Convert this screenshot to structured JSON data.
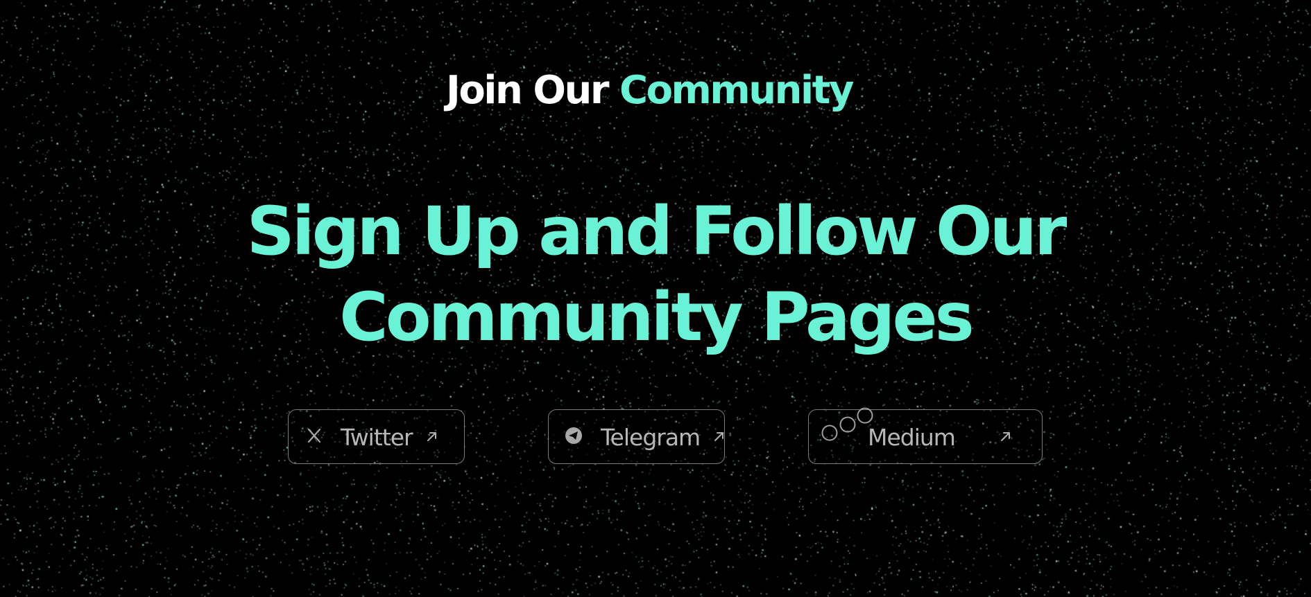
{
  "section": {
    "eyebrow_part1": "Join Our",
    "eyebrow_part2": "Community",
    "headline_line1": "Sign Up and Follow Our",
    "headline_line2": "Community Pages"
  },
  "links": [
    {
      "label": "Twitter",
      "icon": "x-logo-icon"
    },
    {
      "label": "Telegram",
      "icon": "telegram-icon"
    },
    {
      "label": "Medium",
      "icon": "medium-icon"
    }
  ],
  "colors": {
    "background": "#000000",
    "accent": "#6af2d6",
    "text_white": "#ffffff",
    "button_border": "#7d7d7d",
    "button_text": "#b7b7b7"
  }
}
